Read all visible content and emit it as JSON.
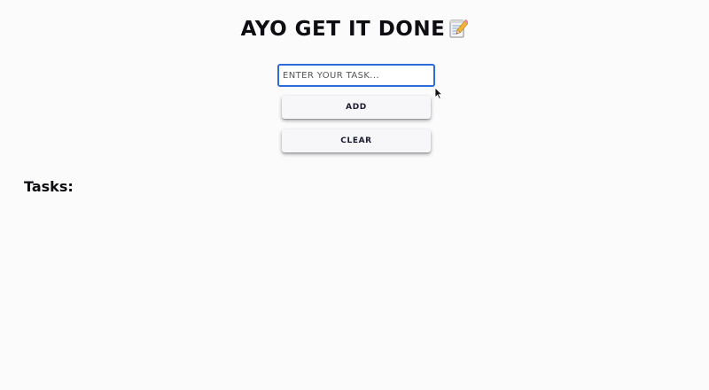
{
  "header": {
    "title": "AYO GET IT DONE",
    "title_icon": "memo-icon"
  },
  "task_input": {
    "placeholder": "ENTER YOUR TASK...",
    "value": ""
  },
  "buttons": {
    "add_label": "ADD",
    "clear_label": "CLEAR"
  },
  "tasks": {
    "heading": "Tasks:",
    "items": []
  },
  "colors": {
    "background": "#fbfbfb",
    "input_border": "#2d6bd6",
    "text": "#0d0d12",
    "button_bg": "#f7f7f9"
  }
}
